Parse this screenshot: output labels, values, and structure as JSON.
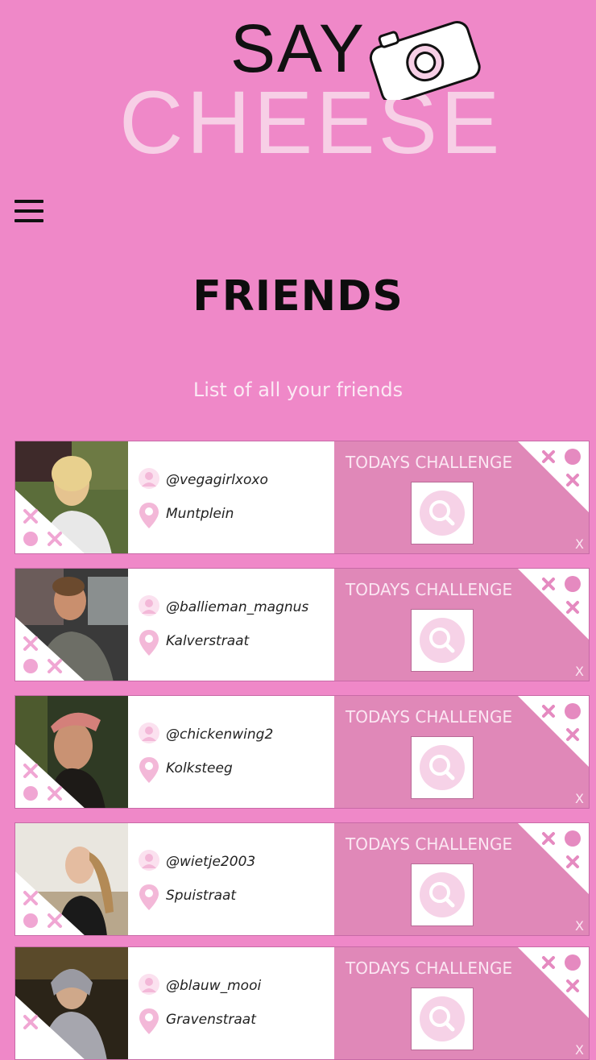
{
  "logo": {
    "line1": "SAY",
    "line2": "CHEESE"
  },
  "page": {
    "title": "FRIENDS",
    "subtitle": "List of all your friends"
  },
  "colors": {
    "background": "#ef88c8",
    "card": "#ffffff",
    "challenge_panel": "#e088b8",
    "accent_light": "#f7cfe6"
  },
  "icons": {
    "menu": "hamburger-menu-icon",
    "user": "user-icon",
    "location": "map-pin-icon",
    "search": "magnifier-icon"
  },
  "friends": [
    {
      "username": "@vegagirlxoxo",
      "location": "Muntplein",
      "challenge_label": "TODAYS CHALLENGE",
      "close_label": "X"
    },
    {
      "username": "@ballieman_magnus",
      "location": "Kalverstraat",
      "challenge_label": "TODAYS CHALLENGE",
      "close_label": "X"
    },
    {
      "username": "@chickenwing2",
      "location": "Kolksteeg",
      "challenge_label": "TODAYS CHALLENGE",
      "close_label": "X"
    },
    {
      "username": "@wietje2003",
      "location": "Spuistraat",
      "challenge_label": "TODAYS CHALLENGE",
      "close_label": "X"
    },
    {
      "username": "@blauw_mooi",
      "location": "Gravenstraat",
      "challenge_label": "TODAYS CHALLENGE",
      "close_label": "X"
    }
  ]
}
